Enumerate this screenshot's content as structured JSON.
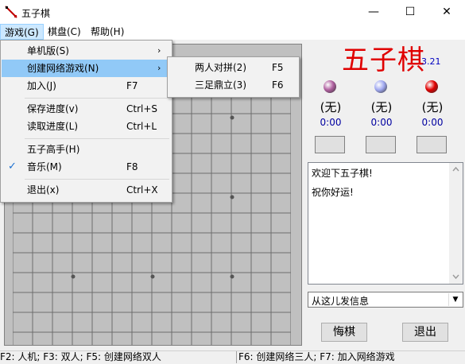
{
  "window": {
    "title": "五子棋",
    "minimize": "—",
    "maximize": "☐",
    "close": "✕"
  },
  "menubar": [
    {
      "label": "游戏(G)"
    },
    {
      "label": "棋盘(C)"
    },
    {
      "label": "帮助(H)"
    }
  ],
  "game_menu": {
    "items": [
      {
        "label": "单机版(S)",
        "shortcut": "",
        "submenu": true
      },
      {
        "label": "创建网络游戏(N)",
        "shortcut": "",
        "submenu": true,
        "highlighted": true
      },
      {
        "label": "加入(J)",
        "shortcut": "F7"
      },
      {
        "label": "保存进度(v)",
        "shortcut": "Ctrl+S"
      },
      {
        "label": "读取进度(L)",
        "shortcut": "Ctrl+L"
      },
      {
        "label": "五子高手(H)",
        "shortcut": ""
      },
      {
        "label": "音乐(M)",
        "shortcut": "F8",
        "checked": true
      },
      {
        "label": "退出(x)",
        "shortcut": "Ctrl+X"
      }
    ],
    "check_glyph": "✓",
    "submenu_arrow": "›"
  },
  "network_submenu": [
    {
      "label": "两人对拼(2)",
      "shortcut": "F5"
    },
    {
      "label": "三足鼎立(3)",
      "shortcut": "F6"
    }
  ],
  "panel": {
    "title": "五子棋",
    "version": "3.21",
    "players": [
      {
        "label": "(无)",
        "time": "0:00",
        "stone_color": "#b060a0"
      },
      {
        "label": "(无)",
        "time": "0:00",
        "stone_color": "#a0a8f0"
      },
      {
        "label": "(无)",
        "time": "0:00",
        "stone_color": "#e00000"
      }
    ],
    "chat_lines": [
      "欢迎下五子棋!",
      "祝你好运!"
    ],
    "message_select": "从这儿发信息",
    "undo_button": "悔棋",
    "exit_button": "退出"
  },
  "statusbar": {
    "left": "F2: 人机; F3: 双人; F5: 创建网络双人",
    "right": "F6: 创建网络三人; F7: 加入网络游戏"
  },
  "colors": {
    "title_red": "#e00000",
    "time_blue": "#0000a0",
    "menu_highlight": "#91c9f7",
    "board_gray": "#c0c0c0"
  }
}
